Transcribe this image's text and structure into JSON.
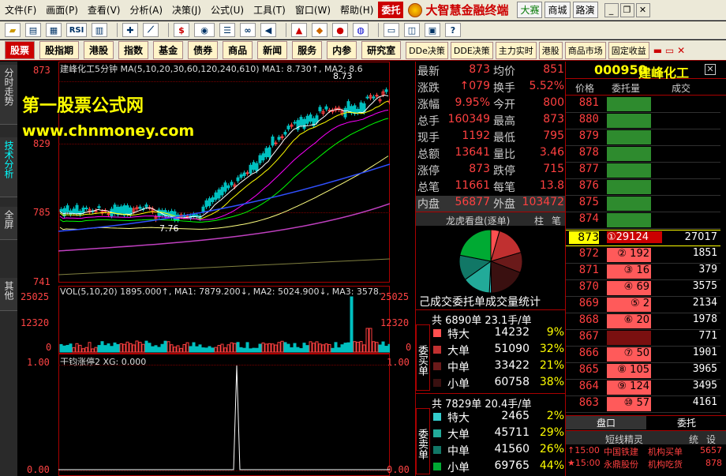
{
  "menu": {
    "items": [
      "文件(F)",
      "画面(P)",
      "查看(V)",
      "分析(A)",
      "决策(J)",
      "公式(U)",
      "工具(T)",
      "窗口(W)",
      "帮助(H)"
    ],
    "selected": "委托",
    "brand": "大智慧金融终端",
    "right_buttons": [
      "大赛",
      "商城",
      "路演"
    ]
  },
  "modules": {
    "main": [
      "股票",
      "股指期",
      "港股",
      "指数",
      "基金",
      "债券",
      "商品",
      "新闻",
      "服务",
      "内参",
      "研究室"
    ],
    "extra": [
      "DDe决策",
      "DDE决策",
      "主力实时",
      "港股",
      "商品市场",
      "固定收益"
    ]
  },
  "left_tabs": [
    "分时走势",
    "技术分析",
    "全屏",
    "其他"
  ],
  "watermark": {
    "line1": "第一股票公式网",
    "line2": "www.chnmoney.com"
  },
  "main_chart": {
    "header": "建峰化工5分钟 MA(5,10,20,30,60,120,240,610) MA1: 8.730↑, MA2: 8.6",
    "y_labels": [
      "873",
      "829",
      "785",
      "741"
    ],
    "price_high_label": "8.73",
    "price_low_label": "7.76",
    "colors": {
      "candle_up": "#ff4040",
      "candle_down": "#00c0c0"
    }
  },
  "vol_chart": {
    "header": "VOL(5,10,20) 1895.000↑, MA1: 7879.200↓, MA2: 5024.900↓, MA3: 3578.",
    "y_labels": [
      "25025",
      "12320",
      "0"
    ],
    "y_labels_right": [
      "25025",
      "12320",
      "0"
    ]
  },
  "ind_chart": {
    "header": "干钧涨停2 XG: 0.000",
    "y_labels": [
      "1.00",
      "0.00"
    ],
    "y_labels_right": [
      "1.00",
      "0.00"
    ]
  },
  "quote": {
    "rows": [
      {
        "l1": "最新",
        "v1": "873",
        "l2": "均价",
        "v2": "851"
      },
      {
        "l1": "涨跌",
        "v1": "↑079",
        "l2": "换手",
        "v2": "5.52%"
      },
      {
        "l1": "涨幅",
        "v1": "9.95%",
        "l2": "今开",
        "v2": "800"
      },
      {
        "l1": "总手",
        "v1": "160349",
        "l2": "最高",
        "v2": "873"
      },
      {
        "l1": "现手",
        "v1": "1192",
        "l2": "最低",
        "v2": "795"
      },
      {
        "l1": "总额",
        "v1": "13641",
        "l2": "量比",
        "v2": "3.46"
      },
      {
        "l1": "涨停",
        "v1": "873",
        "l2": "跌停",
        "v2": "715"
      },
      {
        "l1": "总笔",
        "v1": "11661",
        "l2": "每笔",
        "v2": "13.8"
      },
      {
        "l1": "内盘",
        "v1": "56877",
        "l2": "外盘",
        "v2": "103472"
      }
    ],
    "pie_title": "龙虎看盘(逐单)",
    "pie_btns": [
      "柱",
      "笔"
    ],
    "stat_title": "己成交委托单成交量统计",
    "buy": {
      "summary": "共 6890单 23.1手/单",
      "side": "委买单",
      "rows": [
        {
          "name": "特大",
          "vol": "14232",
          "pct": "9%",
          "color": "#ff5050"
        },
        {
          "name": "大单",
          "vol": "51090",
          "pct": "32%",
          "color": "#c03030"
        },
        {
          "name": "中单",
          "vol": "33422",
          "pct": "21%",
          "color": "#6a1a1a"
        },
        {
          "name": "小单",
          "vol": "60758",
          "pct": "38%",
          "color": "#3a1010"
        }
      ]
    },
    "sell": {
      "summary": "共 7829单 20.4手/单",
      "side": "委卖单",
      "rows": [
        {
          "name": "特大",
          "vol": "2465",
          "pct": "2%",
          "color": "#3cc"
        },
        {
          "name": "大单",
          "vol": "45711",
          "pct": "29%",
          "color": "#2a9"
        },
        {
          "name": "中单",
          "vol": "41560",
          "pct": "26%",
          "color": "#176"
        },
        {
          "name": "小单",
          "vol": "69765",
          "pct": "44%",
          "color": "#0a3"
        }
      ]
    }
  },
  "orderbook": {
    "code": "000950",
    "name": "建峰化工",
    "headers": [
      "价格",
      "委托量",
      "成交"
    ],
    "asks": [
      "881",
      "880",
      "879",
      "878",
      "877",
      "876",
      "875",
      "874"
    ],
    "current": {
      "price": "873",
      "label": "①29124",
      "vol": "27017"
    },
    "bids": [
      {
        "price": "872",
        "q": "② 192",
        "v": "1851"
      },
      {
        "price": "871",
        "q": "③ 16",
        "v": "379"
      },
      {
        "price": "870",
        "q": "④ 69",
        "v": "3575"
      },
      {
        "price": "869",
        "q": "⑤ 2",
        "v": "2134"
      },
      {
        "price": "868",
        "q": "⑥ 20",
        "v": "1978"
      },
      {
        "price": "867",
        "q": "",
        "v": "771"
      },
      {
        "price": "866",
        "q": "⑦ 50",
        "v": "1901"
      },
      {
        "price": "865",
        "q": "⑧ 105",
        "v": "3965"
      },
      {
        "price": "864",
        "q": "⑨ 124",
        "v": "3495"
      },
      {
        "price": "863",
        "q": "⑩ 57",
        "v": "4161"
      }
    ],
    "tabs": [
      "盘口",
      "委托"
    ],
    "short": {
      "title": "短线精灵",
      "btns": [
        "统",
        "设"
      ]
    },
    "news": [
      {
        "time": "↑15:00",
        "name": "中国铁建",
        "act": "机构买单",
        "val": "5657"
      },
      {
        "time": "★15:00",
        "name": "永鼎股份",
        "act": "机构吃货",
        "val": "878"
      }
    ]
  }
}
